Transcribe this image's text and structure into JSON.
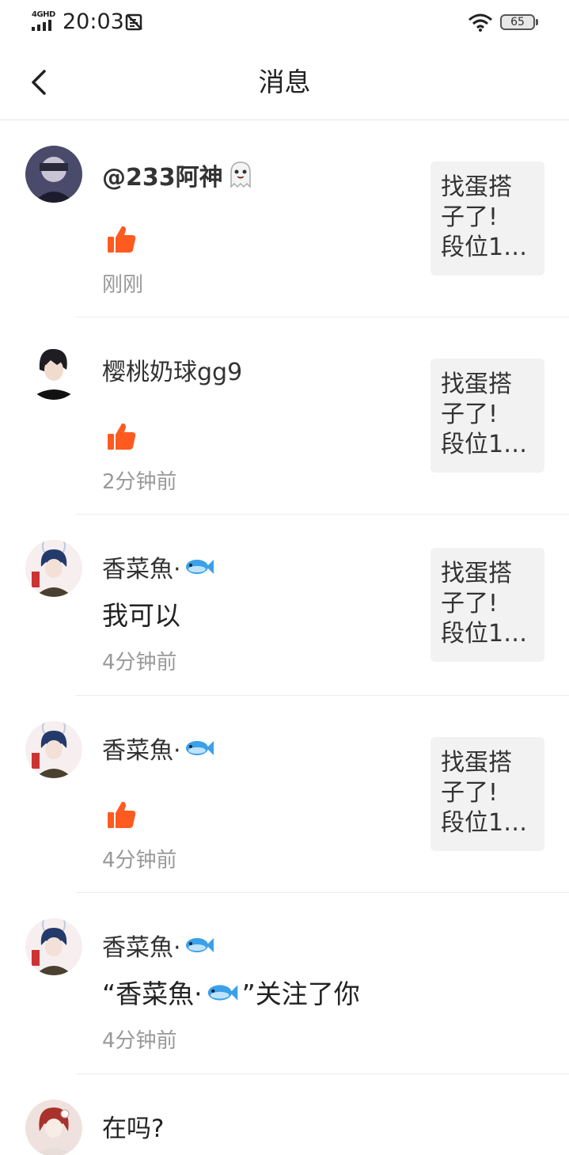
{
  "status_bar": {
    "network": "4GHD",
    "time": "20:03",
    "battery": "65"
  },
  "header": {
    "title": "消息"
  },
  "messages": [
    {
      "name": "@233阿神",
      "name_emoji": "ghost-tongue-emoji",
      "content": "",
      "content_type": "like",
      "time": "刚刚",
      "thumb_lines": [
        "找蛋搭",
        "子了!",
        "段位1…"
      ]
    },
    {
      "name": "樱桃奶球gg9",
      "content": "",
      "content_type": "like",
      "time": "2分钟前",
      "thumb_lines": [
        "找蛋搭",
        "子了!",
        "段位1…"
      ]
    },
    {
      "name": "香菜魚·",
      "name_emoji": "fish-emoji",
      "content": "我可以",
      "content_type": "text",
      "time": "4分钟前",
      "thumb_lines": [
        "找蛋搭",
        "子了!",
        "段位1…"
      ]
    },
    {
      "name": "香菜魚·",
      "name_emoji": "fish-emoji",
      "content": "",
      "content_type": "like",
      "time": "4分钟前",
      "thumb_lines": [
        "找蛋搭",
        "子了!",
        "段位1…"
      ]
    },
    {
      "name": "香菜魚·",
      "name_emoji": "fish-emoji",
      "content_prefix": "“香菜魚·",
      "content_suffix": "”关注了你",
      "content_type": "follow",
      "time": "4分钟前"
    },
    {
      "name": "",
      "content": "在吗?",
      "content_type": "text"
    }
  ],
  "colors": {
    "like": "#ff5a1f",
    "secondary_text": "#999999",
    "thumb_bg": "#f2f2f2"
  }
}
